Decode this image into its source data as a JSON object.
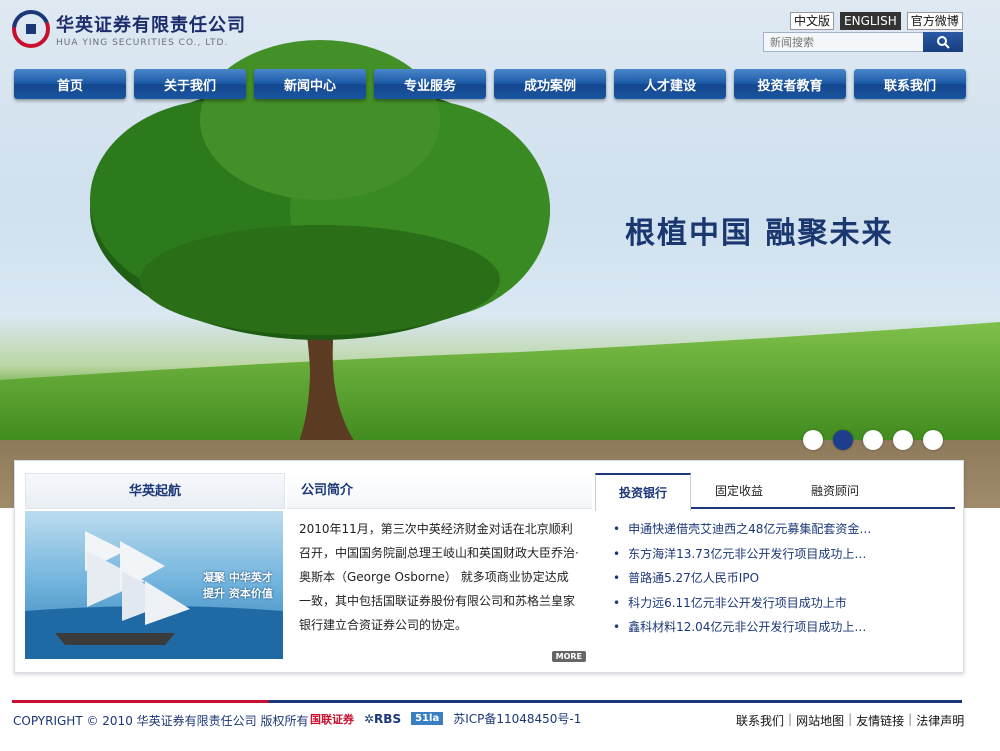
{
  "brand": {
    "name_cn": "华英证券有限责任公司",
    "name_en": "HUA YING SECURITIES CO., LTD."
  },
  "header": {
    "languages": [
      "中文版",
      "ENGLISH",
      "官方微博"
    ],
    "search_placeholder": "新闻搜索"
  },
  "nav": [
    "首页",
    "关于我们",
    "新闻中心",
    "专业服务",
    "成功案例",
    "人才建设",
    "投资者教育",
    "联系我们"
  ],
  "hero": {
    "slogan": "根植中国   融聚未来",
    "slide_count": 5,
    "active_slide": 2
  },
  "panel_launch": {
    "title": "华英起航",
    "caption_line1": "凝聚 中华英才",
    "caption_line2": "提升 资本价值"
  },
  "panel_intro": {
    "title": "公司简介",
    "body": "2010年11月，第三次中英经济财金对话在北京顺利召开，中国国务院副总理王岐山和英国财政大臣乔治·奥斯本（George Osborne） 就多项商业协定达成一致，其中包括国联证券股份有限公司和苏格兰皇家银行建立合资证券公司的协定。",
    "more": "MORE"
  },
  "panel_news": {
    "tabs": [
      "投资银行",
      "固定收益",
      "融资顾问"
    ],
    "active_tab": 0,
    "items": [
      "申通快递借壳艾迪西之48亿元募集配套资金…",
      "东方海洋13.73亿元非公开发行项目成功上…",
      "普路通5.27亿人民币IPO",
      "科力远6.11亿元非公开发行项目成功上市",
      "鑫科材料12.04亿元非公开发行项目成功上…"
    ]
  },
  "footer": {
    "copyright": "COPYRIGHT © 2010 华英证券有限责任公司  版权所有",
    "partner1": "国联证券",
    "partner2": "✲RBS",
    "badge": "51la",
    "icp": "苏ICP备11048450号-1",
    "links": [
      "联系我们",
      "网站地图",
      "友情链接",
      "法律声明"
    ]
  },
  "colors": {
    "brand_navy": "#1c3778",
    "brand_red": "#c8102e",
    "nav_blue": "#1c5aa7"
  }
}
